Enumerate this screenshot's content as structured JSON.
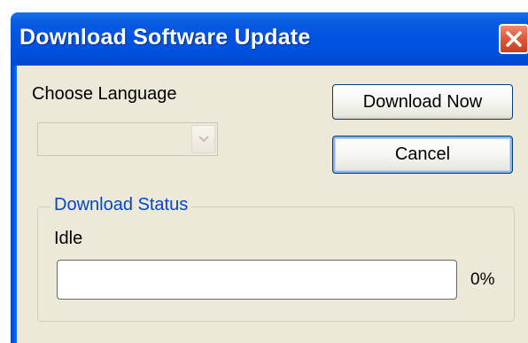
{
  "window": {
    "title": "Download Software Update",
    "close_icon": "close-x-icon"
  },
  "language": {
    "label": "Choose Language",
    "selected": "",
    "dropdown_icon": "chevron-down-icon",
    "enabled": false
  },
  "buttons": {
    "download_label": "Download Now",
    "cancel_label": "Cancel"
  },
  "status": {
    "group_label": "Download Status",
    "state_text": "Idle",
    "progress_value": 0,
    "progress_label": "0%"
  },
  "colors": {
    "title_bar": "#0054e3",
    "close_button": "#e05a3a",
    "dialog_background": "#ece9d8",
    "group_label": "#0046d5"
  }
}
